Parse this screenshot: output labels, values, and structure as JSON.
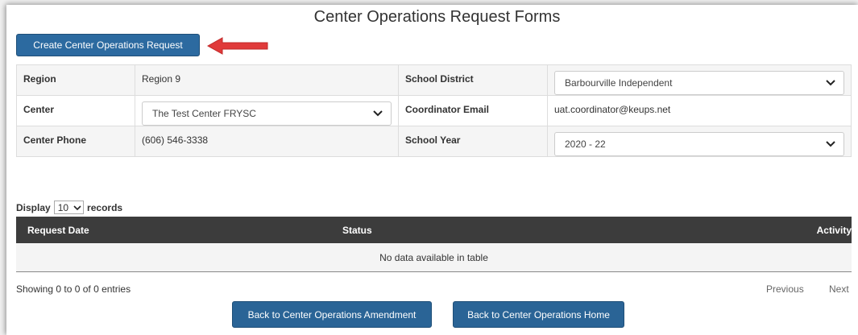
{
  "page_title": "Center Operations Request Forms",
  "create_button_label": "Create Center Operations Request",
  "colors": {
    "primary_button": "#2a6496",
    "arrow": "#e03a3a",
    "table_header": "#3c3c3c"
  },
  "info": {
    "region_label": "Region",
    "region_value": "Region 9",
    "school_district_label": "School District",
    "school_district_value": "Barbourville Independent",
    "center_label": "Center",
    "center_value": "The Test Center FRYSC",
    "coordinator_email_label": "Coordinator Email",
    "coordinator_email_value": "uat.coordinator@keups.net",
    "center_phone_label": "Center Phone",
    "center_phone_value": "(606) 546-3338",
    "school_year_label": "School Year",
    "school_year_value": "2020 - 22"
  },
  "display": {
    "prefix": "Display",
    "value": "10",
    "suffix": "records"
  },
  "table": {
    "columns": [
      "Request Date",
      "Status",
      "Activity"
    ],
    "empty_message": "No data available in table"
  },
  "showing_text": "Showing 0 to 0 of 0 entries",
  "pager": {
    "previous": "Previous",
    "next": "Next"
  },
  "back_amendment_label": "Back to Center Operations Amendment",
  "back_home_label": "Back to Center Operations Home"
}
